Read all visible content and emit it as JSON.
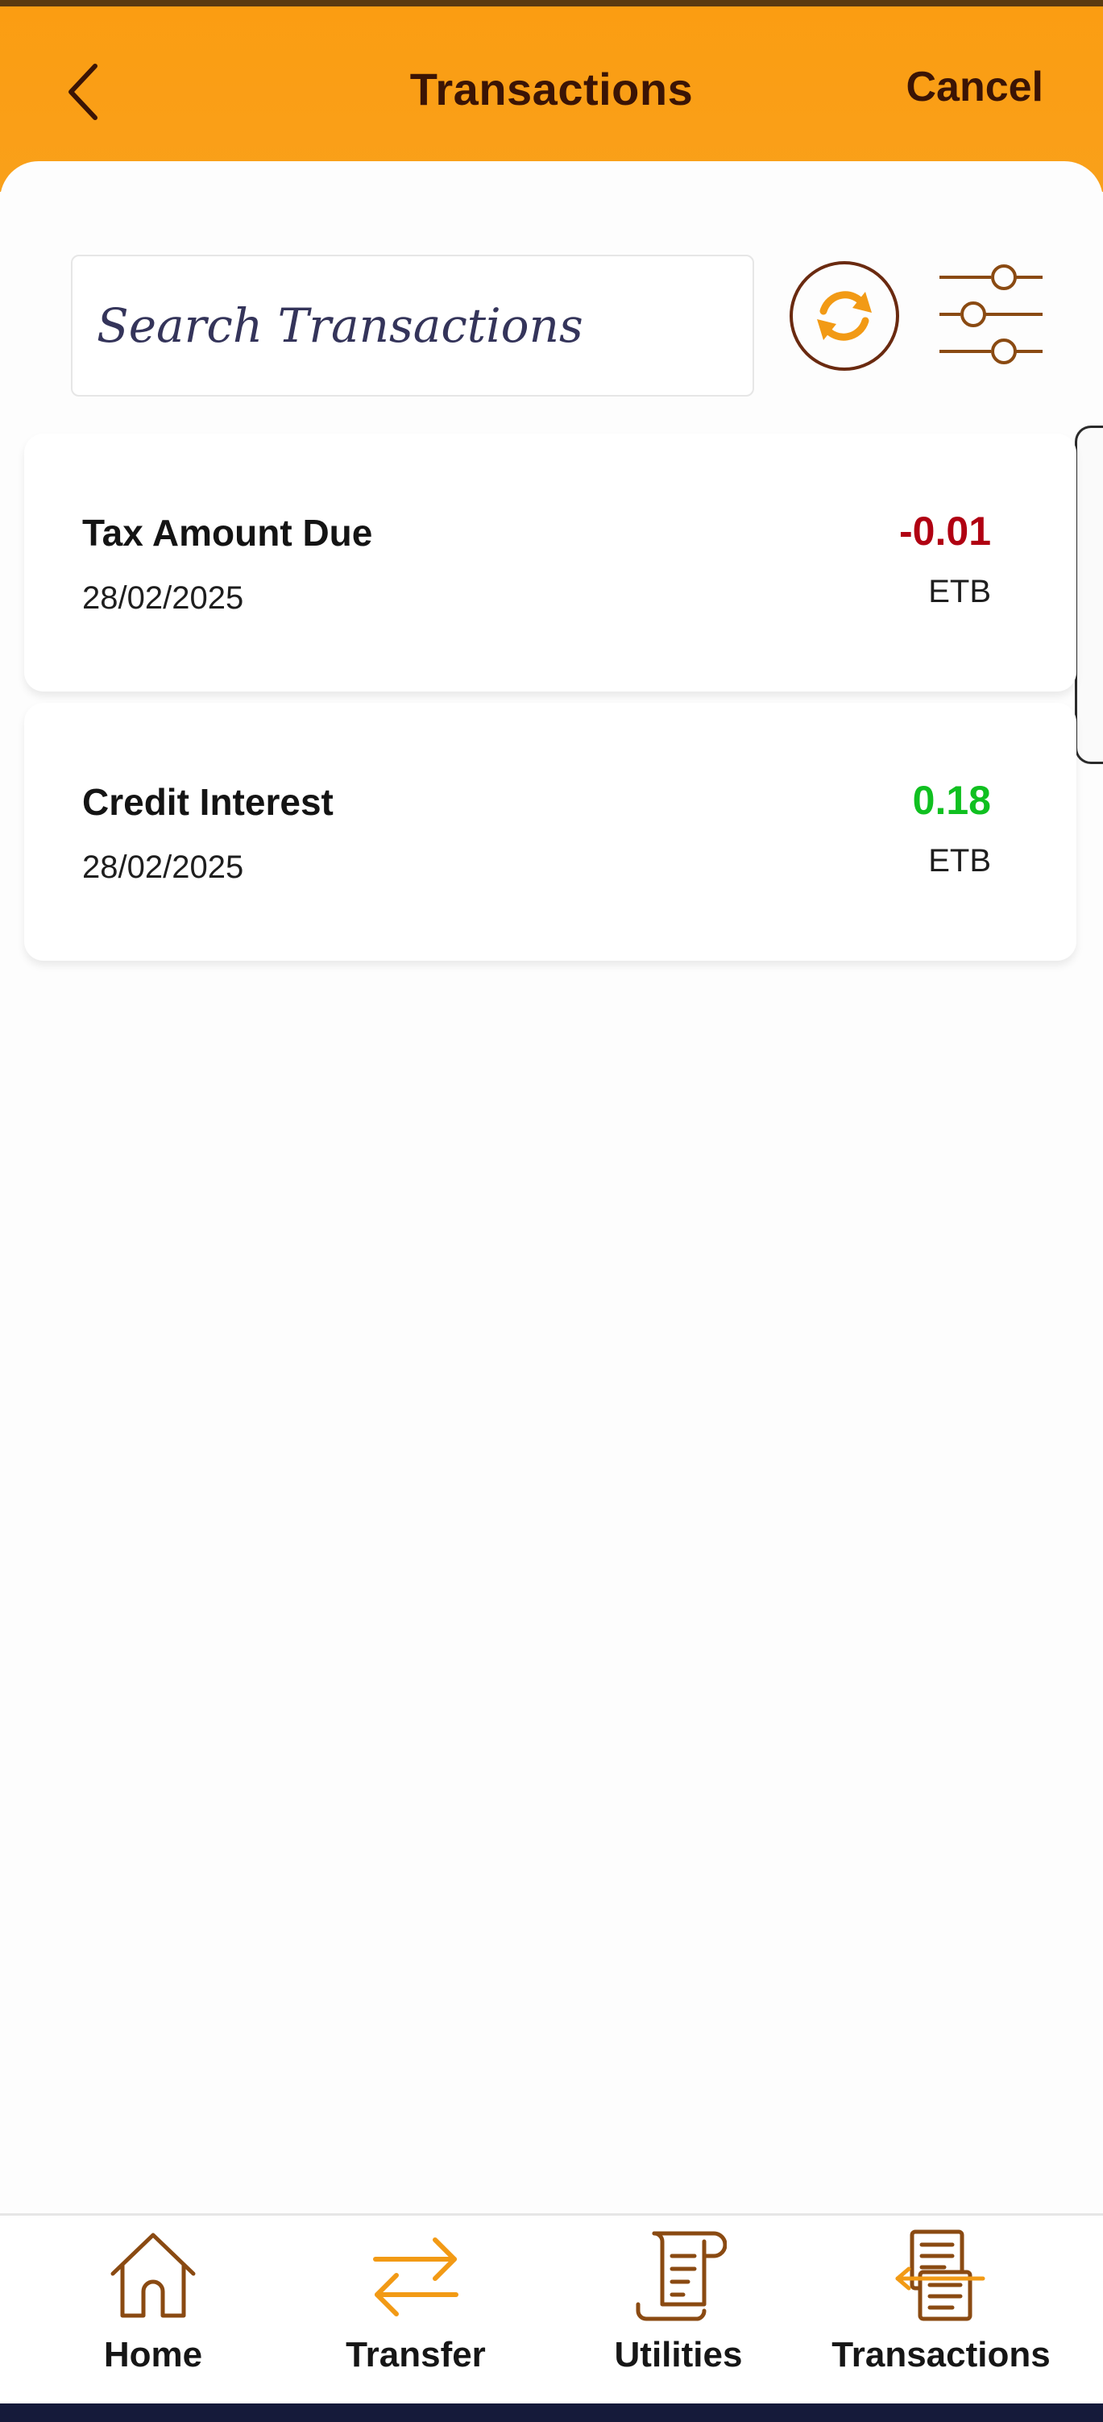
{
  "header": {
    "title": "Transactions",
    "cancel_label": "Cancel",
    "back_icon": "chevron-left-icon"
  },
  "search": {
    "placeholder": "Search Transactions",
    "value": ""
  },
  "toolbar": {
    "refresh_icon": "refresh-icon",
    "filter_icon": "filter-sliders-icon"
  },
  "transactions": [
    {
      "name": "Tax Amount Due",
      "date": "28/02/2025",
      "amount": "-0.01",
      "currency": "ETB",
      "amount_color": "#b00012"
    },
    {
      "name": "Credit Interest",
      "date": "28/02/2025",
      "amount": "0.18",
      "currency": "ETB",
      "amount_color": "#10c020"
    }
  ],
  "bottom_nav": [
    {
      "label": "Home",
      "icon": "home-icon"
    },
    {
      "label": "Transfer",
      "icon": "transfer-arrows-icon"
    },
    {
      "label": "Utilities",
      "icon": "utilities-receipt-icon"
    },
    {
      "label": "Transactions",
      "icon": "transactions-list-icon"
    }
  ],
  "colors": {
    "header_bg": "#fb9d12",
    "header_text": "#3b1405",
    "icon_brown": "#8a4a12",
    "accent_orange": "#f29a15",
    "negative": "#b00012",
    "positive": "#10c020"
  }
}
